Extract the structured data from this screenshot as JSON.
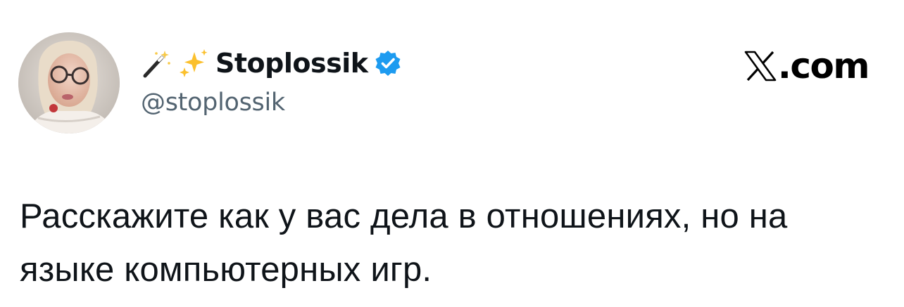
{
  "author": {
    "display_name": "Stoplossik",
    "handle": "@stoplossik",
    "verified": true,
    "name_emojis": [
      "magic-wand-icon",
      "sparkles-icon"
    ],
    "verified_color": "#1d9bf0"
  },
  "site": {
    "label": ".com",
    "logo_icon": "x-logo-icon"
  },
  "tweet": {
    "text": "Расскажите как у вас дела в отношениях, но на языке компьютерных игр."
  },
  "colors": {
    "text": "#0f1419",
    "secondary": "#536471",
    "background": "#ffffff"
  }
}
